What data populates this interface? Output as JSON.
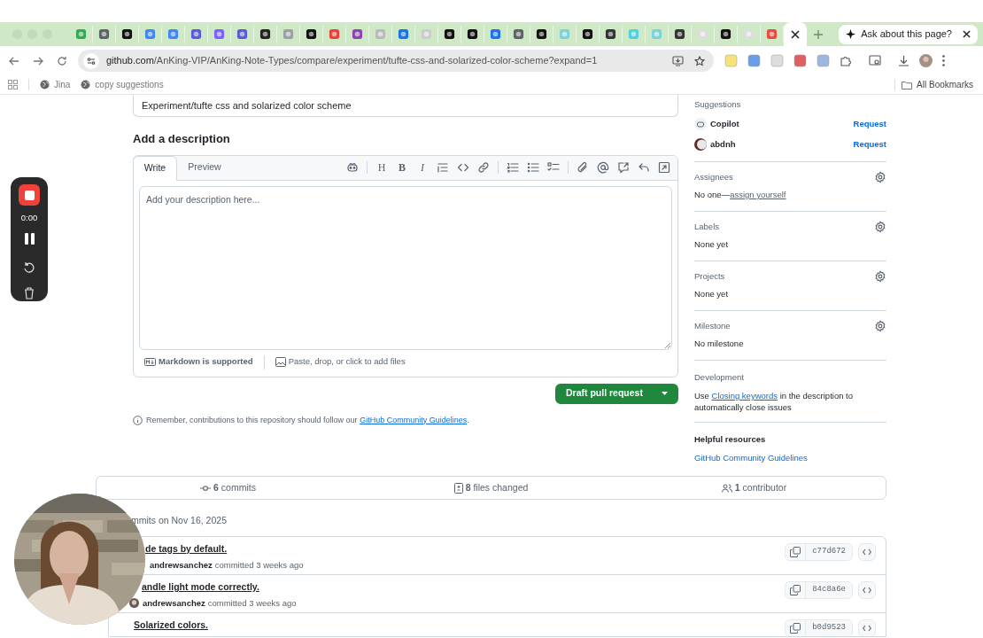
{
  "browser": {
    "tabs": [
      {
        "selected": false
      },
      {
        "selected": false
      },
      {
        "selected": false
      },
      {
        "selected": false
      },
      {
        "selected": false
      },
      {
        "selected": false
      },
      {
        "selected": false
      },
      {
        "selected": false
      },
      {
        "selected": false
      },
      {
        "selected": false
      },
      {
        "selected": false
      },
      {
        "selected": false
      },
      {
        "selected": false
      },
      {
        "selected": false
      },
      {
        "selected": false
      },
      {
        "selected": false
      },
      {
        "selected": false
      },
      {
        "selected": false
      },
      {
        "selected": false
      },
      {
        "selected": false
      },
      {
        "selected": false
      },
      {
        "selected": false
      },
      {
        "selected": false
      },
      {
        "selected": false
      },
      {
        "selected": false
      },
      {
        "selected": false
      },
      {
        "selected": false
      },
      {
        "selected": false
      },
      {
        "selected": false
      },
      {
        "selected": false
      },
      {
        "selected": false
      },
      {
        "selected": true
      }
    ],
    "ask_button": "Ask about this page?",
    "url_host": "github.com",
    "url_path": "/AnKing-VIP/AnKing-Note-Types/compare/experiment/tufte-css-and-solarized-color-scheme?expand=1",
    "bookmarks": [
      "Jina",
      "copy suggestions"
    ],
    "all_bookmarks": "All Bookmarks"
  },
  "recorder": {
    "time": "0:00"
  },
  "title_field": {
    "value": "Experiment/tufte css and solarized color scheme"
  },
  "description": {
    "heading": "Add a description",
    "tabs": [
      {
        "label": "Write",
        "selected": true
      },
      {
        "label": "Preview",
        "selected": false
      }
    ],
    "format_glyphs": [
      "H",
      "B",
      "I"
    ],
    "placeholder": "Add your description here...",
    "markdown_note": "Markdown is supported",
    "attach_note": "Paste, drop, or click to add files"
  },
  "submit_button": "Draft pull request",
  "remember": {
    "text": "Remember, contributions to this repository should follow our ",
    "link": "GitHub Community Guidelines",
    "after": "."
  },
  "sidebar": {
    "suggestions": {
      "heading": "Suggestions",
      "reviewers": [
        {
          "name": "Copilot",
          "action": "Request",
          "kind": "bot"
        },
        {
          "name": "abdnh",
          "action": "Request",
          "kind": "user"
        }
      ]
    },
    "sections": [
      {
        "heading": "Assignees",
        "value": "No one—",
        "link": "assign yourself"
      },
      {
        "heading": "Labels",
        "value": "None yet"
      },
      {
        "heading": "Projects",
        "value": "None yet"
      },
      {
        "heading": "Milestone",
        "value": "No milestone"
      }
    ],
    "development": {
      "heading": "Development",
      "before": "Use ",
      "link": "Closing keywords",
      "after": " in the description to automatically close issues"
    },
    "resources": {
      "heading": "Helpful resources",
      "link": "GitHub Community Guidelines"
    }
  },
  "stats": [
    "**6** commits",
    "**8** files changed",
    "**1** contributor"
  ],
  "commits_heading": "mmits on Nov 16, 2025",
  "commits": [
    {
      "title": "de tags by default.",
      "author": "andrewsanchez",
      "meta": "committed 3 weeks ago",
      "sha": "c77d672"
    },
    {
      "title": "andle light mode correctly.",
      "author": "andrewsanchez",
      "meta": "committed 3 weeks ago",
      "sha": "84c8a6e"
    },
    {
      "title": "Solarized colors.",
      "sha": "b0d9523"
    }
  ],
  "webcam": {
    "kind": "picture"
  }
}
